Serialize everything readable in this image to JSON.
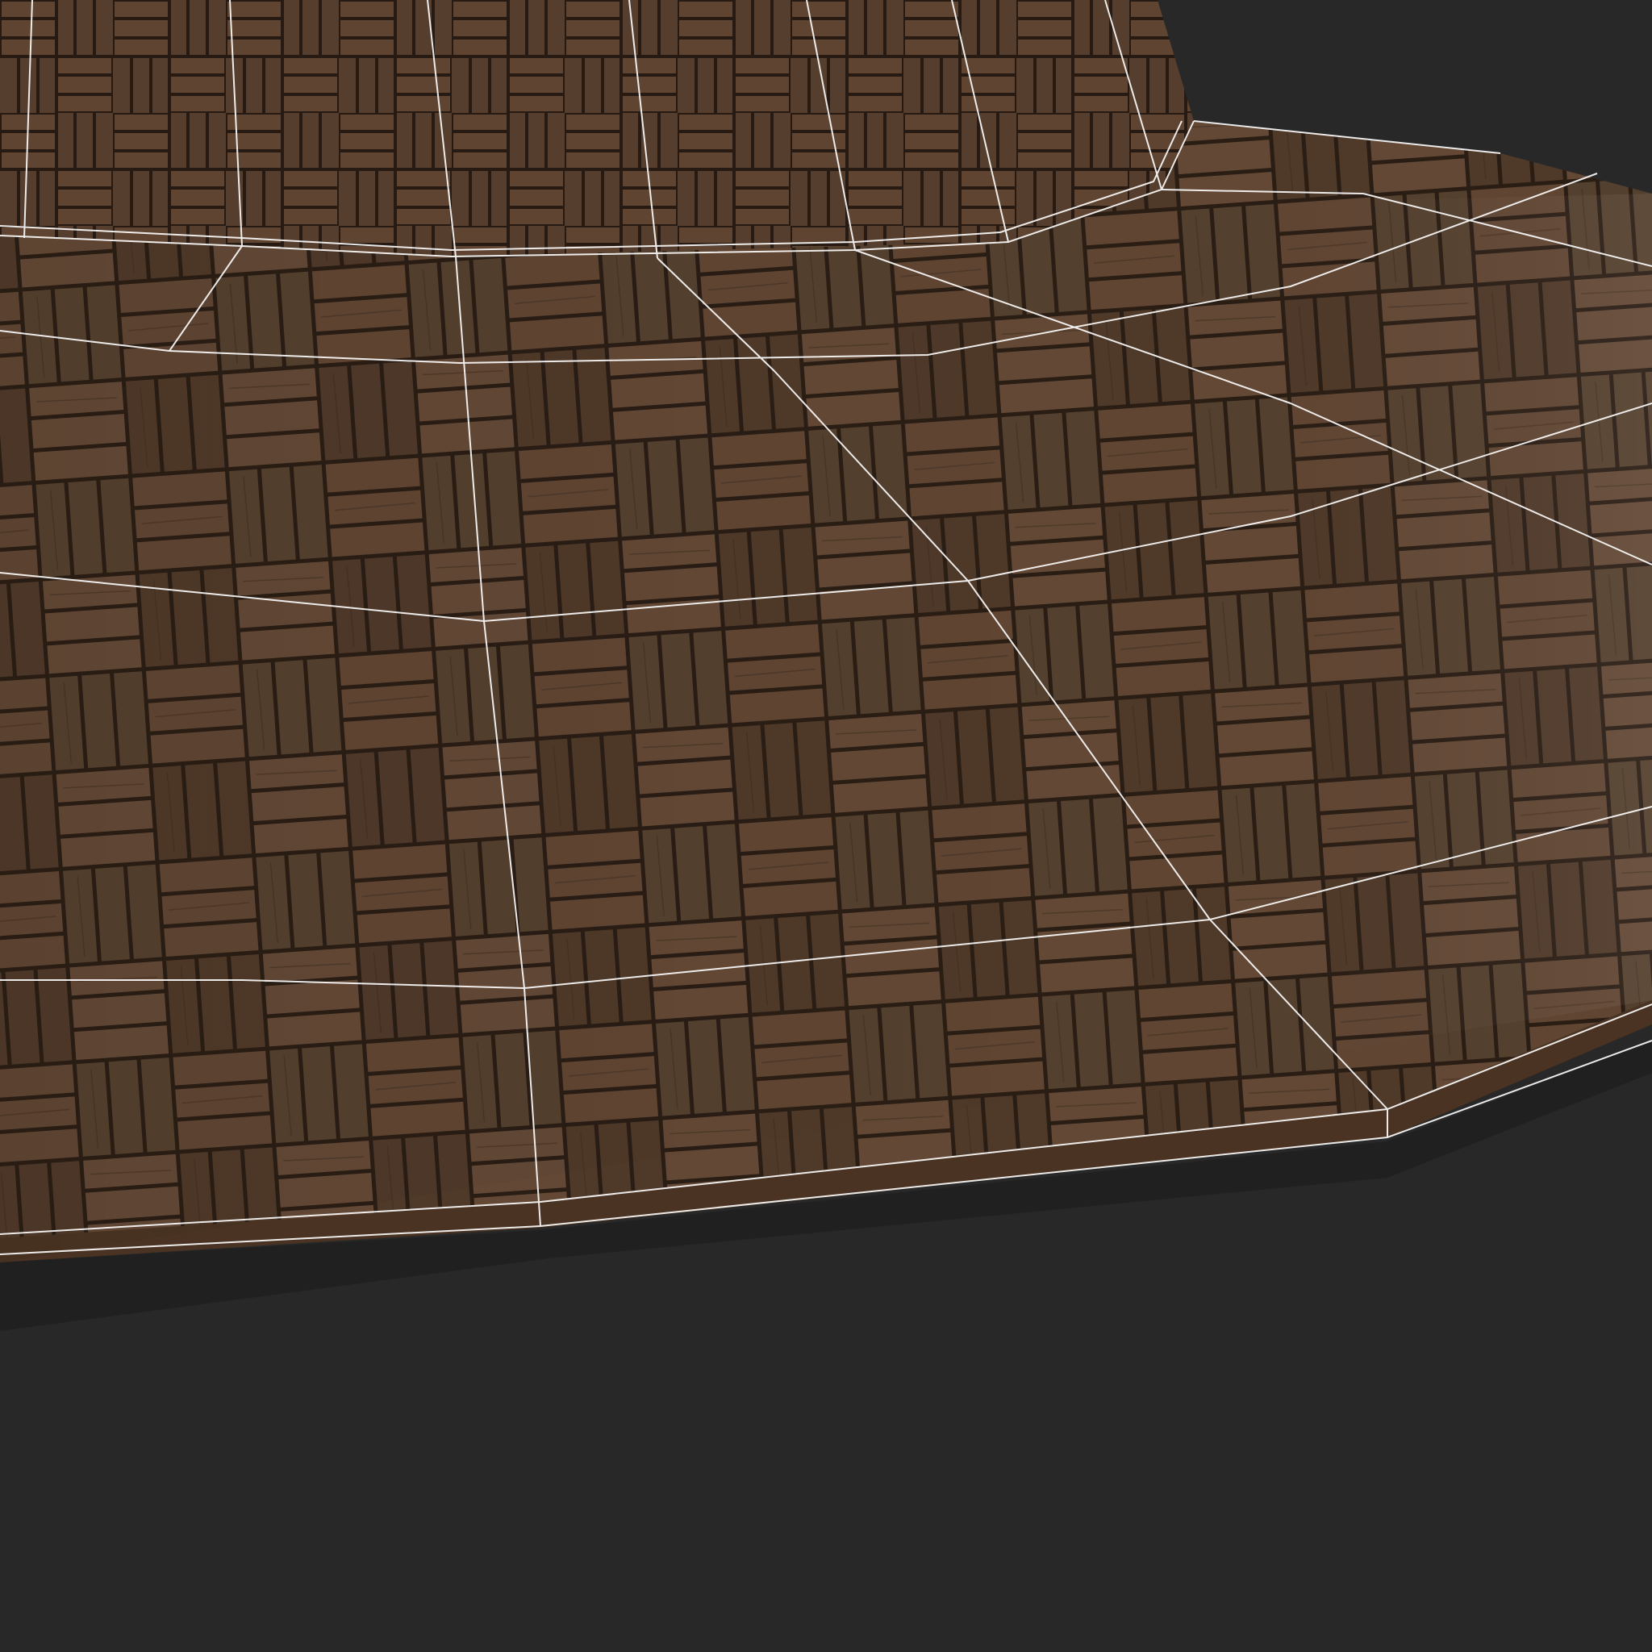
{
  "scene": {
    "background_color": "#282828",
    "wood_base_color": "#5a4230",
    "wood_dark_color": "#2e2118",
    "wood_light_color": "#7a5a40",
    "wireframe_color": "#ffffff",
    "shadow_color": "#1c1c1c"
  }
}
